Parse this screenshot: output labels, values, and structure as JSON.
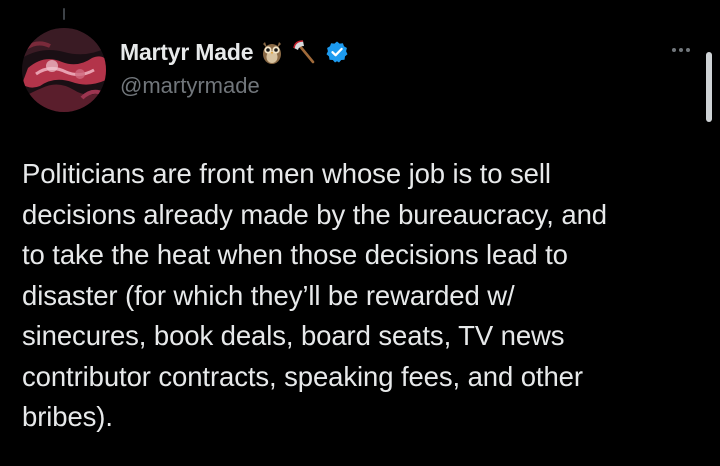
{
  "author": {
    "display_name": "Martyr Made",
    "handle": "@martyrmade",
    "name_emojis": [
      "owl-icon",
      "axe-icon"
    ],
    "verified_icon": "verified-badge-icon",
    "verified_color": "#1d9bf0"
  },
  "tweet": {
    "lines": [
      "Politicians are front men whose job is to sell",
      "decisions already made by the bureaucracy, and",
      "to take the heat when those decisions lead to",
      "disaster (for which they’ll be rewarded w/",
      "sinecures, book deals, board seats, TV news",
      "contributor contracts, speaking fees, and other",
      "bribes)."
    ]
  },
  "actions": {
    "more_icon": "more-options-icon"
  },
  "colors": {
    "background": "#000000",
    "primary_text": "#e7e9ea",
    "secondary_text": "#71767b"
  }
}
